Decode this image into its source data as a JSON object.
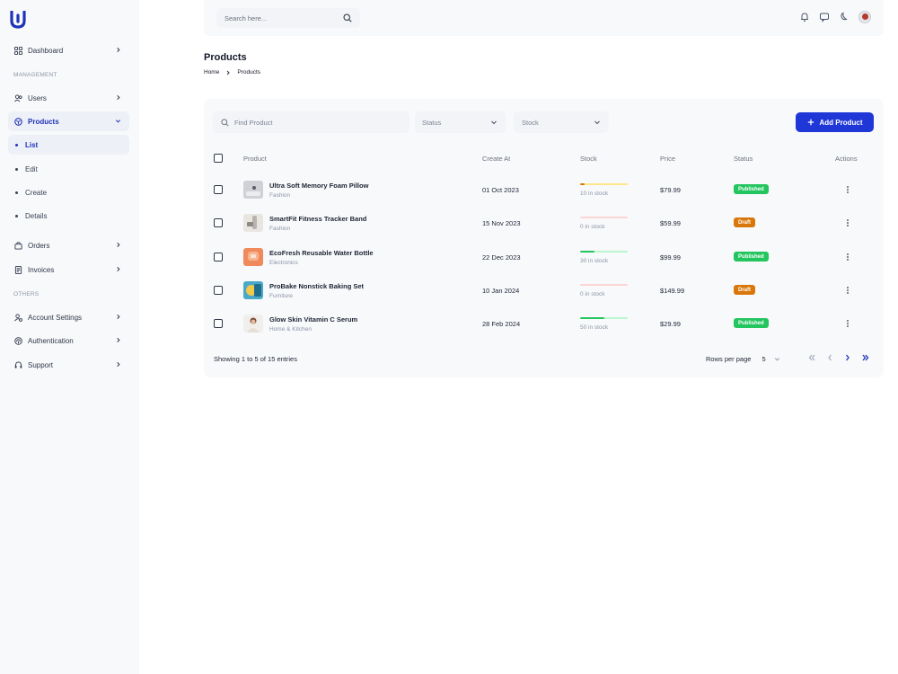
{
  "brand": {
    "logo_letter": "U",
    "color": "#1f33b8"
  },
  "sidebar": {
    "dashboard": "Dashboard",
    "section_management": "MANAGEMENT",
    "users": "Users",
    "products": "Products",
    "sub_items": [
      "List",
      "Edit",
      "Create",
      "Details"
    ],
    "orders": "Orders",
    "invoices": "Invoices",
    "section_others": "OTHERS",
    "account_settings": "Account Settings",
    "authentication": "Authentication",
    "support": "Support"
  },
  "topbar": {
    "search_placeholder": "Search here...",
    "icons": [
      "bell-icon",
      "chat-icon",
      "moon-icon",
      "user-avatar"
    ]
  },
  "page": {
    "title": "Products",
    "breadcrumb": [
      "Home",
      "Products"
    ]
  },
  "filters": {
    "find_placeholder": "Find Product",
    "status_label": "Status",
    "stock_label": "Stock",
    "add_button": "Add Product"
  },
  "table": {
    "headers": [
      "Product",
      "Create At",
      "Stock",
      "Price",
      "Status",
      "Actions"
    ],
    "rows": [
      {
        "name": "Ultra Soft Memory Foam Pillow",
        "category": "Fashion",
        "created": "01 Oct 2023",
        "stock_text": "10 in stock",
        "stock_level": 0.1,
        "stock_color": "#d9770b",
        "stock_track": "#fde68a",
        "price": "$79.99",
        "status": "Published",
        "status_color": "#22c55e"
      },
      {
        "name": "SmartFit Fitness Tracker Band",
        "category": "Fashion",
        "created": "15 Nov 2023",
        "stock_text": "0 in stock",
        "stock_level": 0,
        "stock_color": "#ef4444",
        "stock_track": "#fcd5d5",
        "price": "$59.99",
        "status": "Draft",
        "status_color": "#d9770b"
      },
      {
        "name": "EcoFresh Reusable Water Bottle",
        "category": "Electronics",
        "created": "22 Dec 2023",
        "stock_text": "30 in stock",
        "stock_level": 0.3,
        "stock_color": "#22c55e",
        "stock_track": "#bbf7d0",
        "price": "$99.99",
        "status": "Published",
        "status_color": "#22c55e"
      },
      {
        "name": "ProBake Nonstick Baking Set",
        "category": "Furniture",
        "created": "10 Jan 2024",
        "stock_text": "0 in stock",
        "stock_level": 0,
        "stock_color": "#ef4444",
        "stock_track": "#fcd5d5",
        "price": "$149.99",
        "status": "Draft",
        "status_color": "#d9770b"
      },
      {
        "name": "Glow Skin Vitamin C Serum",
        "category": "Home & Kitchen",
        "created": "28 Feb 2024",
        "stock_text": "50 in stock",
        "stock_level": 0.5,
        "stock_color": "#22c55e",
        "stock_track": "#bbf7d0",
        "price": "$29.99",
        "status": "Published",
        "status_color": "#22c55e"
      }
    ]
  },
  "footer": {
    "showing": "Showing 1 to 5 of 15 entries",
    "rows_per_page_label": "Rows per page",
    "rows_per_page_value": "5"
  }
}
